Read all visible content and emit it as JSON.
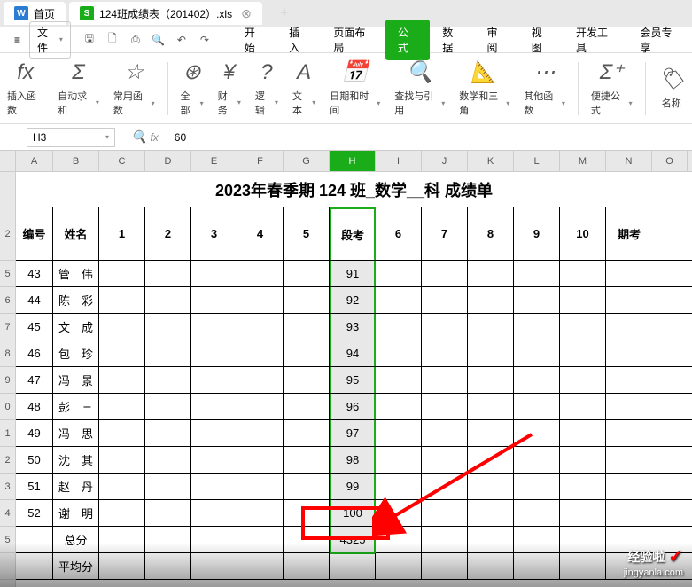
{
  "tabs": {
    "home": "首页",
    "file": "124班成绩表（201402）.xls",
    "add_icon": "+"
  },
  "menu": {
    "hamburger": "≡",
    "file": "文件",
    "tabs": [
      "开始",
      "插入",
      "页面布局",
      "公式",
      "数据",
      "审阅",
      "视图",
      "开发工具",
      "会员专享"
    ]
  },
  "ribbon": {
    "insert_func": "插入函数",
    "auto_sum": "自动求和",
    "frequent": "常用函数",
    "all": "全部",
    "financial": "财务",
    "logical": "逻辑",
    "text": "文本",
    "date_time": "日期和时间",
    "lookup": "查找与引用",
    "math_trig": "数学和三角",
    "other": "其他函数",
    "convenience": "便捷公式",
    "name": "名称"
  },
  "formula_bar": {
    "cell": "H3",
    "fx": "fx",
    "value": "60"
  },
  "sheet": {
    "columns": [
      "A",
      "B",
      "C",
      "D",
      "E",
      "F",
      "G",
      "H",
      "I",
      "J",
      "K",
      "L",
      "M",
      "N",
      "O"
    ],
    "title": "2023年春季期 124 班_数学__科 成绩单",
    "headers": [
      "编号",
      "姓名",
      "1",
      "2",
      "3",
      "4",
      "5",
      "段考",
      "6",
      "7",
      "8",
      "9",
      "10",
      "期考"
    ],
    "row_nums_left": [
      "2",
      "5",
      "6",
      "7",
      "8",
      "9",
      "0",
      "1",
      "2",
      "3",
      "4",
      "5",
      ""
    ],
    "rows": [
      {
        "id": "43",
        "name": "管　伟",
        "seg": "91"
      },
      {
        "id": "44",
        "name": "陈　彩",
        "seg": "92"
      },
      {
        "id": "45",
        "name": "文　成",
        "seg": "93"
      },
      {
        "id": "46",
        "name": "包　珍",
        "seg": "94"
      },
      {
        "id": "47",
        "name": "冯　景",
        "seg": "95"
      },
      {
        "id": "48",
        "name": "彭　三",
        "seg": "96"
      },
      {
        "id": "49",
        "name": "冯　思",
        "seg": "97"
      },
      {
        "id": "50",
        "name": "沈　其",
        "seg": "98"
      },
      {
        "id": "51",
        "name": "赵　丹",
        "seg": "99"
      },
      {
        "id": "52",
        "name": "谢　明",
        "seg": "100"
      }
    ],
    "total_label": "总分",
    "total_value": "4325",
    "avg_label": "平均分"
  },
  "watermark": {
    "title": "经验啦",
    "url": "jingyanla.com"
  }
}
